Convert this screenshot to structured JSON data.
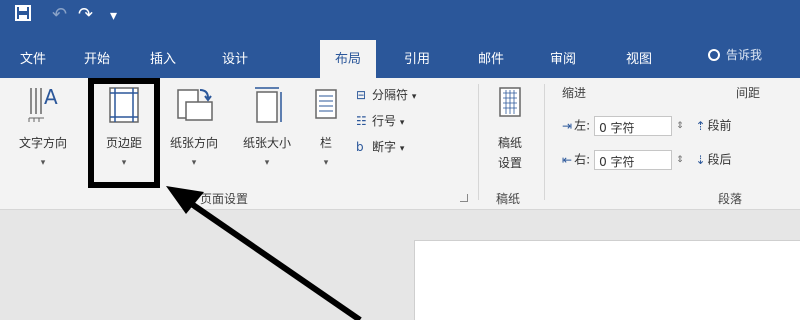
{
  "quick_access": {
    "save_icon": "save-icon",
    "undo_icon": "undo-icon",
    "redo_icon": "redo-icon",
    "customize_icon": "customize-qat-icon"
  },
  "tabs": [
    {
      "label": "文件"
    },
    {
      "label": "开始"
    },
    {
      "label": "插入"
    },
    {
      "label": "设计"
    },
    {
      "label": "布局"
    },
    {
      "label": "引用"
    },
    {
      "label": "邮件"
    },
    {
      "label": "审阅"
    },
    {
      "label": "视图"
    }
  ],
  "tell_me": {
    "text": "告诉我"
  },
  "page_setup": {
    "text_direction": "文字方向",
    "margins": "页边距",
    "orientation": "纸张方向",
    "size": "纸张大小",
    "columns": "栏",
    "breaks": "分隔符",
    "line_numbers": "行号",
    "hyphenation": "断字",
    "group_label": "页面设置"
  },
  "draft": {
    "setup": "稿纸",
    "setup2": "设置",
    "group_label": "稿纸"
  },
  "paragraph": {
    "indent_header": "缩进",
    "spacing_header": "间距",
    "left_label": "左:",
    "left_value": "0 字符",
    "right_label": "右:",
    "right_value": "0 字符",
    "spacing_before": "段前",
    "spacing_after": "段后",
    "group_label": "段落"
  },
  "colors": {
    "accent": "#2b579a",
    "highlight_border": "#000000"
  }
}
